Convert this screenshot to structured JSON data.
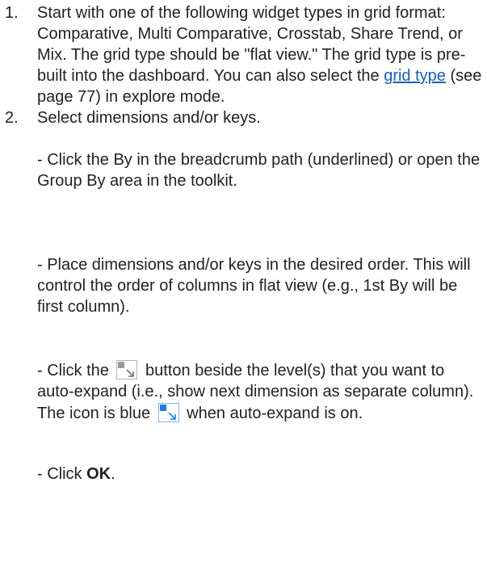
{
  "steps": [
    {
      "number": "1.",
      "text_before_link": "Start with one of the following widget types in grid format: Comparative, Multi Comparative, Crosstab, Share Trend, or Mix. The grid type should be \"flat view.\" The grid type is pre-built into the dashboard. You can also select the ",
      "link_text": "grid type",
      "text_after_link": " (see page 77) in explore mode."
    },
    {
      "number": "2.",
      "text": "Select dimensions and/or keys."
    }
  ],
  "sub_steps": [
    {
      "text": " - Click the By in the breadcrumb path (underlined) or open the Group By area in the toolkit."
    },
    {
      "text": " - Place dimensions and/or keys in the desired order. This will control the order of columns in flat view (e.g., 1st By will be first column)."
    },
    {
      "text_before_icon": " - Click the ",
      "icon_name": "auto-expand-icon",
      "text_middle": " button beside the level(s) that you want to auto-expand (i.e., show next dimension as separate column). The icon is blue ",
      "icon2_name": "auto-expand-active-icon",
      "text_after_icon": " when auto-expand is on."
    },
    {
      "text_before_bold": " - Click ",
      "bold_text": "OK",
      "text_after_bold": "."
    }
  ],
  "colors": {
    "link": "#1a5fb4",
    "icon_active": "#1e7fe0",
    "icon_inactive": "#9a9a9a"
  }
}
